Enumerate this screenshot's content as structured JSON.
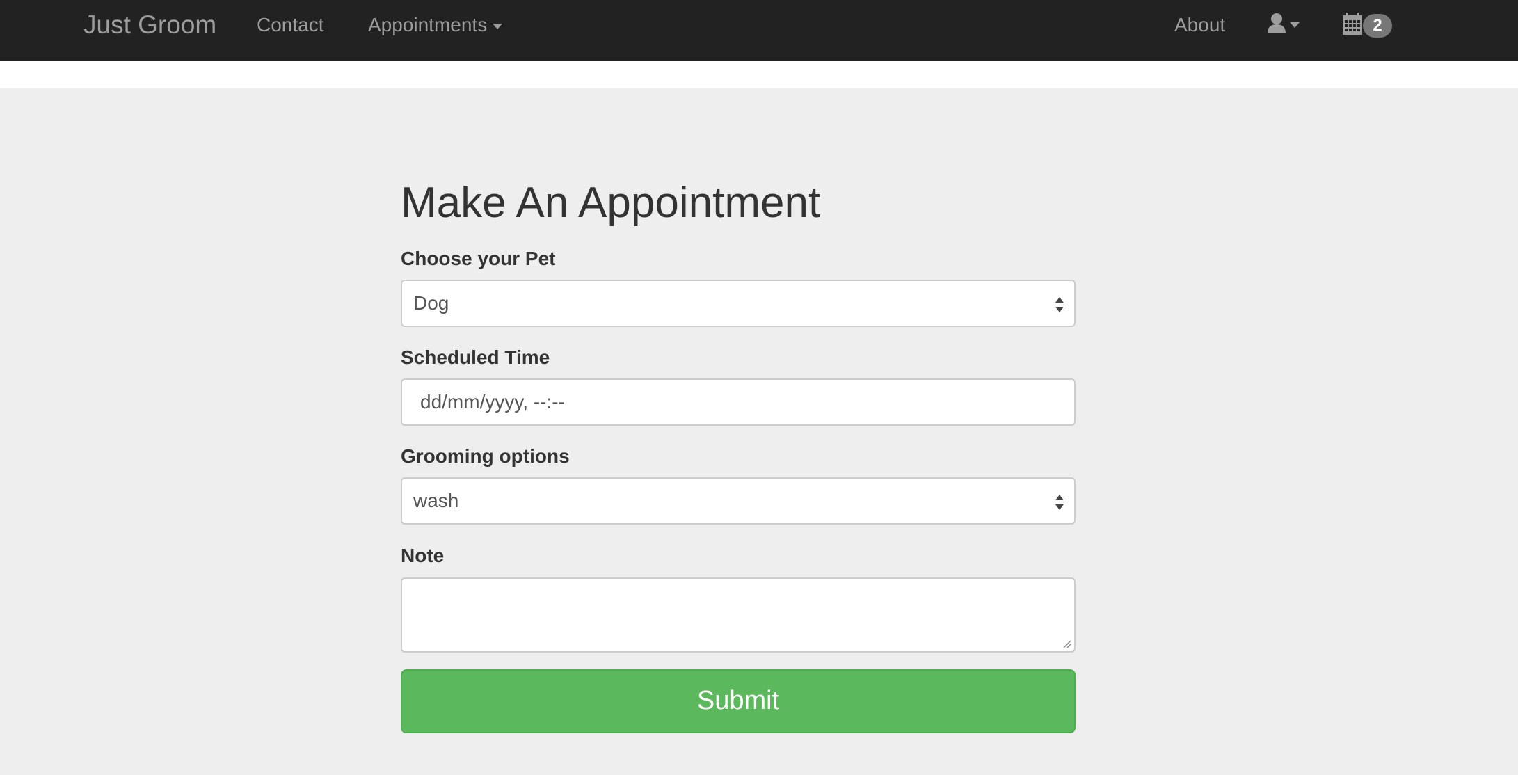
{
  "navbar": {
    "brand": "Just Groom",
    "contact_label": "Contact",
    "appointments_label": "Appointments",
    "about_label": "About",
    "calendar_badge_count": "2",
    "icons": [
      "user-icon",
      "calendar-icon"
    ]
  },
  "form": {
    "title": "Make An Appointment",
    "pet_label": "Choose your Pet",
    "pet_value": "Dog",
    "time_label": "Scheduled Time",
    "time_placeholder": "dd/mm/yyyy, --:--",
    "grooming_label": "Grooming options",
    "grooming_value": "wash",
    "note_label": "Note",
    "note_value": "",
    "submit_label": "Submit"
  },
  "colors": {
    "navbar_bg": "#222222",
    "nav_text": "#9d9d9d",
    "page_bg": "#eeeeee",
    "submit_bg": "#5cb85c"
  }
}
